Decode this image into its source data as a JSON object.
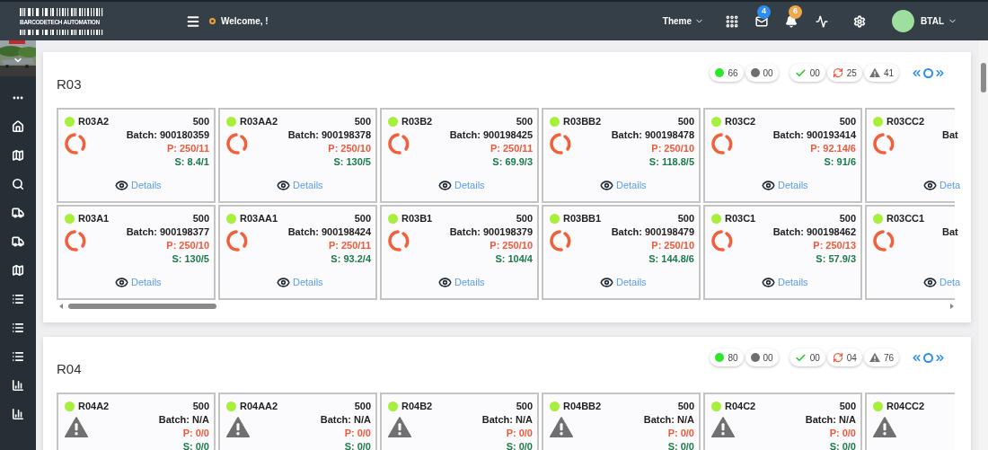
{
  "header": {
    "logo_text": "BARCODETECH AUTOMATION",
    "welcome": "Welcome, !",
    "theme": "Theme",
    "mail_count": "4",
    "notification_count": "6",
    "user": "BTAL"
  },
  "sections": [
    {
      "title": "R03",
      "stats": [
        {
          "kind": "online",
          "count": "66"
        },
        {
          "kind": "offline",
          "count": "00"
        },
        {
          "kind": "done",
          "count": "00"
        },
        {
          "kind": "syncing",
          "count": "25"
        },
        {
          "kind": "alert",
          "count": "41"
        }
      ],
      "rows": [
        [
          {
            "kind": "syncing",
            "clipped": false,
            "name": "R03A2",
            "quantity": "500",
            "batch": "Batch: 900180359",
            "p": "P: 250/11",
            "s": "S: 8.4/1",
            "details": "Details"
          },
          {
            "kind": "syncing",
            "clipped": false,
            "name": "R03AA2",
            "quantity": "500",
            "batch": "Batch: 900198378",
            "p": "P: 250/10",
            "s": "S: 130/5",
            "details": "Details"
          },
          {
            "kind": "syncing",
            "clipped": false,
            "name": "R03B2",
            "quantity": "500",
            "batch": "Batch: 900198425",
            "p": "P: 250/11",
            "s": "S: 69.9/3",
            "details": "Details"
          },
          {
            "kind": "syncing",
            "clipped": false,
            "name": "R03BB2",
            "quantity": "500",
            "batch": "Batch: 900198478",
            "p": "P: 250/10",
            "s": "S: 118.8/5",
            "details": "Details"
          },
          {
            "kind": "syncing",
            "clipped": false,
            "name": "R03C2",
            "quantity": "500",
            "batch": "Batch: 900193414",
            "p": "P: 92.14/6",
            "s": "S: 91/6",
            "details": "Details"
          },
          {
            "kind": "syncing",
            "clipped": true,
            "name": "R03CC2",
            "batch": "Bat",
            "details": "Deta"
          }
        ],
        [
          {
            "kind": "syncing",
            "clipped": false,
            "name": "R03A1",
            "quantity": "500",
            "batch": "Batch: 900198377",
            "p": "P: 250/10",
            "s": "S: 130/5",
            "details": "Details"
          },
          {
            "kind": "syncing",
            "clipped": false,
            "name": "R03AA1",
            "quantity": "500",
            "batch": "Batch: 900198424",
            "p": "P: 250/11",
            "s": "S: 93.2/4",
            "details": "Details"
          },
          {
            "kind": "syncing",
            "clipped": false,
            "name": "R03B1",
            "quantity": "500",
            "batch": "Batch: 900198379",
            "p": "P: 250/10",
            "s": "S: 104/4",
            "details": "Details"
          },
          {
            "kind": "syncing",
            "clipped": false,
            "name": "R03BB1",
            "quantity": "500",
            "batch": "Batch: 900198479",
            "p": "P: 250/10",
            "s": "S: 144.8/6",
            "details": "Details"
          },
          {
            "kind": "syncing",
            "clipped": false,
            "name": "R03C1",
            "quantity": "500",
            "batch": "Batch: 900198462",
            "p": "P: 250/13",
            "s": "S: 57.9/3",
            "details": "Details"
          },
          {
            "kind": "syncing",
            "clipped": true,
            "name": "R03CC1",
            "batch": "Bat",
            "details": "Deta"
          }
        ]
      ]
    },
    {
      "title": "R04",
      "stats": [
        {
          "kind": "online",
          "count": "80"
        },
        {
          "kind": "offline",
          "count": "00"
        },
        {
          "kind": "done",
          "count": "00"
        },
        {
          "kind": "syncing",
          "count": "04"
        },
        {
          "kind": "alert",
          "count": "76"
        }
      ],
      "rows": [
        [
          {
            "kind": "alert",
            "clipped": false,
            "name": "R04A2",
            "quantity": "500",
            "batch": "Batch: N/A",
            "p": "P: 0/0",
            "s": "S: 0/0"
          },
          {
            "kind": "alert",
            "clipped": false,
            "name": "R04AA2",
            "quantity": "500",
            "batch": "Batch: N/A",
            "p": "P: 0/0",
            "s": "S: 0/0"
          },
          {
            "kind": "alert",
            "clipped": false,
            "name": "R04B2",
            "quantity": "500",
            "batch": "Batch: N/A",
            "p": "P: 0/0",
            "s": "S: 0/0"
          },
          {
            "kind": "alert",
            "clipped": false,
            "name": "R04BB2",
            "quantity": "500",
            "batch": "Batch: N/A",
            "p": "P: 0/0",
            "s": "S: 0/0"
          },
          {
            "kind": "alert",
            "clipped": false,
            "name": "R04C2",
            "quantity": "500",
            "batch": "Batch: N/A",
            "p": "P: 0/0",
            "s": "S: 0/0"
          },
          {
            "kind": "alert",
            "clipped": true,
            "name": "R04CC2"
          }
        ]
      ]
    }
  ]
}
